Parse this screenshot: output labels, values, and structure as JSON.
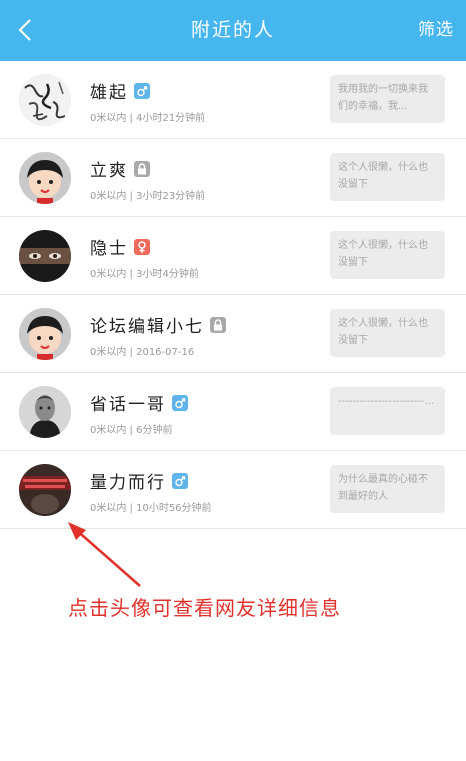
{
  "header": {
    "title": "附近的人",
    "filter_label": "筛选",
    "back_icon": "chevron-left-icon"
  },
  "colors": {
    "header_bg": "#45b6ee",
    "male_badge": "#5fb4ea",
    "female_badge": "#f06b5b",
    "private_badge": "#a9a9a9",
    "annotation": "#e0322b"
  },
  "users": [
    {
      "name": "雄起",
      "gender": "male",
      "meta": "0米以内 | 4小时21分钟前",
      "signature": "我用我的一切换来我们的幸福，我..."
    },
    {
      "name": "立爽",
      "gender": "private",
      "meta": "0米以内 | 3小时23分钟前",
      "signature": "这个人很懒，什么也没留下"
    },
    {
      "name": "隐士",
      "gender": "female",
      "meta": "0米以内 | 3小时4分钟前",
      "signature": "这个人很懒，什么也没留下"
    },
    {
      "name": "论坛编辑小七",
      "gender": "private",
      "meta": "0米以内 | 2016-07-16",
      "signature": "这个人很懒，什么也没留下"
    },
    {
      "name": "省话一哥",
      "gender": "male",
      "meta": "0米以内 | 6分钟前",
      "signature": "------------------------..."
    },
    {
      "name": "量力而行",
      "gender": "male",
      "meta": "0米以内 | 10小时56分钟前",
      "signature": "为什么最真的心碰不到最好的人"
    }
  ],
  "annotation": {
    "text": "点击头像可查看网友详细信息"
  }
}
